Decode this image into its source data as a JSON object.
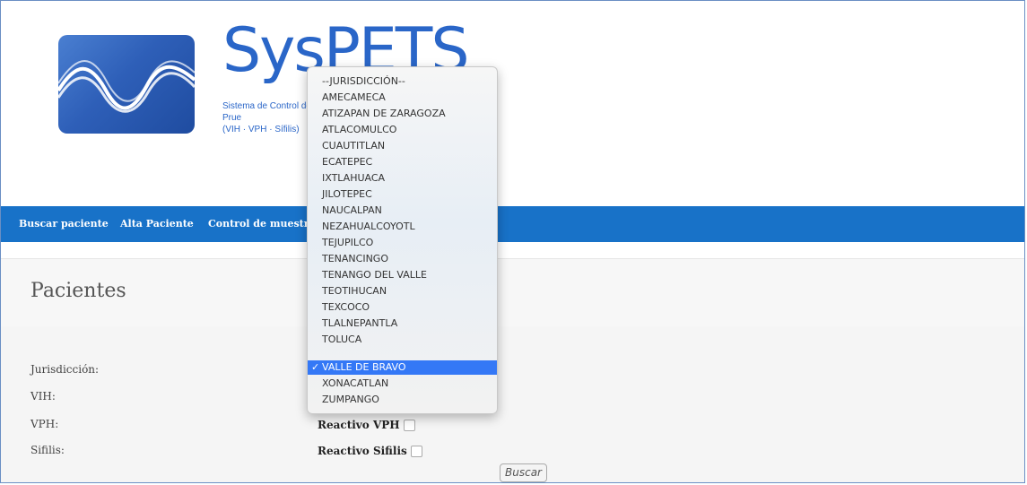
{
  "logo": {
    "title": "SysPETS",
    "subtitle_line1": "Sistema de Control de Prue",
    "subtitle_line2": "(VIH · VPH · Sífilis)"
  },
  "nav": {
    "items": [
      "Buscar paciente",
      "Alta Paciente",
      "Control de muestra"
    ]
  },
  "page": {
    "title": "Pacientes"
  },
  "form": {
    "labels": {
      "jurisdiccion": "Jurisdicción:",
      "vih": "VIH:",
      "vph": "VPH:",
      "sifilis": "Sifilis:"
    },
    "checks": {
      "vph": "Reactivo VPH",
      "sifilis": "Reactivo Sifilis"
    },
    "search_button": "Buscar"
  },
  "dropdown": {
    "selected": "VALLE DE BRAVO",
    "check_glyph": "✓",
    "options": [
      "--JURISDICCIÓN--",
      "AMECAMECA",
      "ATIZAPAN DE ZARAGOZA",
      "ATLACOMULCO",
      "CUAUTITLAN",
      "ECATEPEC",
      "IXTLAHUACA",
      "JILOTEPEC",
      "NAUCALPAN",
      "NEZAHUALCOYOTL",
      "TEJUPILCO",
      "TENANCINGO",
      "TENANGO DEL VALLE",
      "TEOTIHUCAN",
      "TEXCOCO",
      "TLALNEPANTLA",
      "TOLUCA",
      "VALLE DE BRAVO",
      "XONACATLAN",
      "ZUMPANGO"
    ]
  },
  "colors": {
    "brand_blue": "#2a66c8",
    "nav_blue": "#1872c8",
    "selection_blue": "#3478f6"
  }
}
